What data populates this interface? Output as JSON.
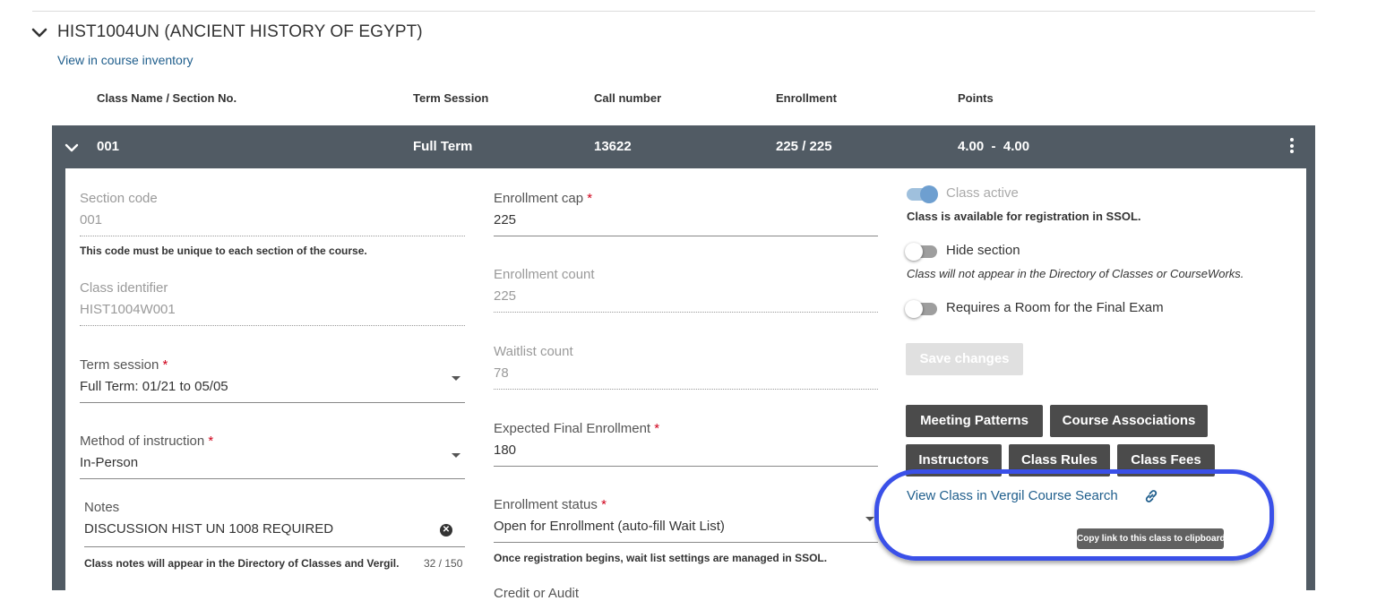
{
  "course": {
    "title": "HIST1004UN (ANCIENT HISTORY OF EGYPT)",
    "inventory_link": "View in course inventory"
  },
  "columns": [
    "Class Name / Section No.",
    "Term Session",
    "Call number",
    "Enrollment",
    "Points"
  ],
  "section_row": {
    "section": "001",
    "term": "Full Term",
    "call_number": "13622",
    "enrollment": "225 / 225",
    "points": "4.00  -  4.00"
  },
  "form": {
    "section_code": {
      "label": "Section code",
      "value": "001",
      "help": "This code must be unique to each section of the course."
    },
    "class_identifier": {
      "label": "Class identifier",
      "value": "HIST1004W001"
    },
    "term_session": {
      "label": "Term session",
      "required": "*",
      "value": "Full Term: 01/21 to 05/05"
    },
    "method": {
      "label": "Method of instruction",
      "required": "*",
      "value": "In-Person"
    },
    "notes": {
      "label": "Notes",
      "value": "DISCUSSION HIST UN 1008 REQUIRED",
      "help": "Class notes will appear in the Directory of Classes and Vergil.",
      "counter": "32 / 150"
    },
    "enrollment_cap": {
      "label": "Enrollment cap",
      "required": "*",
      "value": "225"
    },
    "enrollment_count": {
      "label": "Enrollment count",
      "value": "225"
    },
    "waitlist_count": {
      "label": "Waitlist count",
      "value": "78"
    },
    "expected_final": {
      "label": "Expected Final Enrollment",
      "required": "*",
      "value": "180"
    },
    "enrollment_status": {
      "label": "Enrollment status",
      "required": "*",
      "value": "Open for Enrollment (auto-fill Wait List)",
      "help": "Once registration begins, wait list settings are managed in SSOL."
    },
    "credit_label": "Credit or Audit"
  },
  "settings": {
    "class_active": {
      "label": "Class active",
      "help": "Class is available for registration in SSOL.",
      "on": true
    },
    "hide_section": {
      "label": "Hide section",
      "help": "Class will not appear in the Directory of Classes or CourseWorks.",
      "on": false
    },
    "requires_room": {
      "label": "Requires a Room for the Final Exam",
      "on": false
    },
    "save_label": "Save changes"
  },
  "buttons": {
    "meeting_patterns": "Meeting Patterns",
    "course_associations": "Course Associations",
    "instructors": "Instructors",
    "class_rules": "Class Rules",
    "class_fees": "Class Fees"
  },
  "vergil": {
    "link": "View Class in Vergil Course Search",
    "tooltip": "Copy link to this class to clipboard"
  },
  "colors": {
    "row_bar": "#515b64",
    "button": "#4b4b4b",
    "link": "#1f5e8c",
    "required": "#d0021b",
    "highlight": "#3a50e8",
    "toggle_active": "#9fc0dd"
  }
}
